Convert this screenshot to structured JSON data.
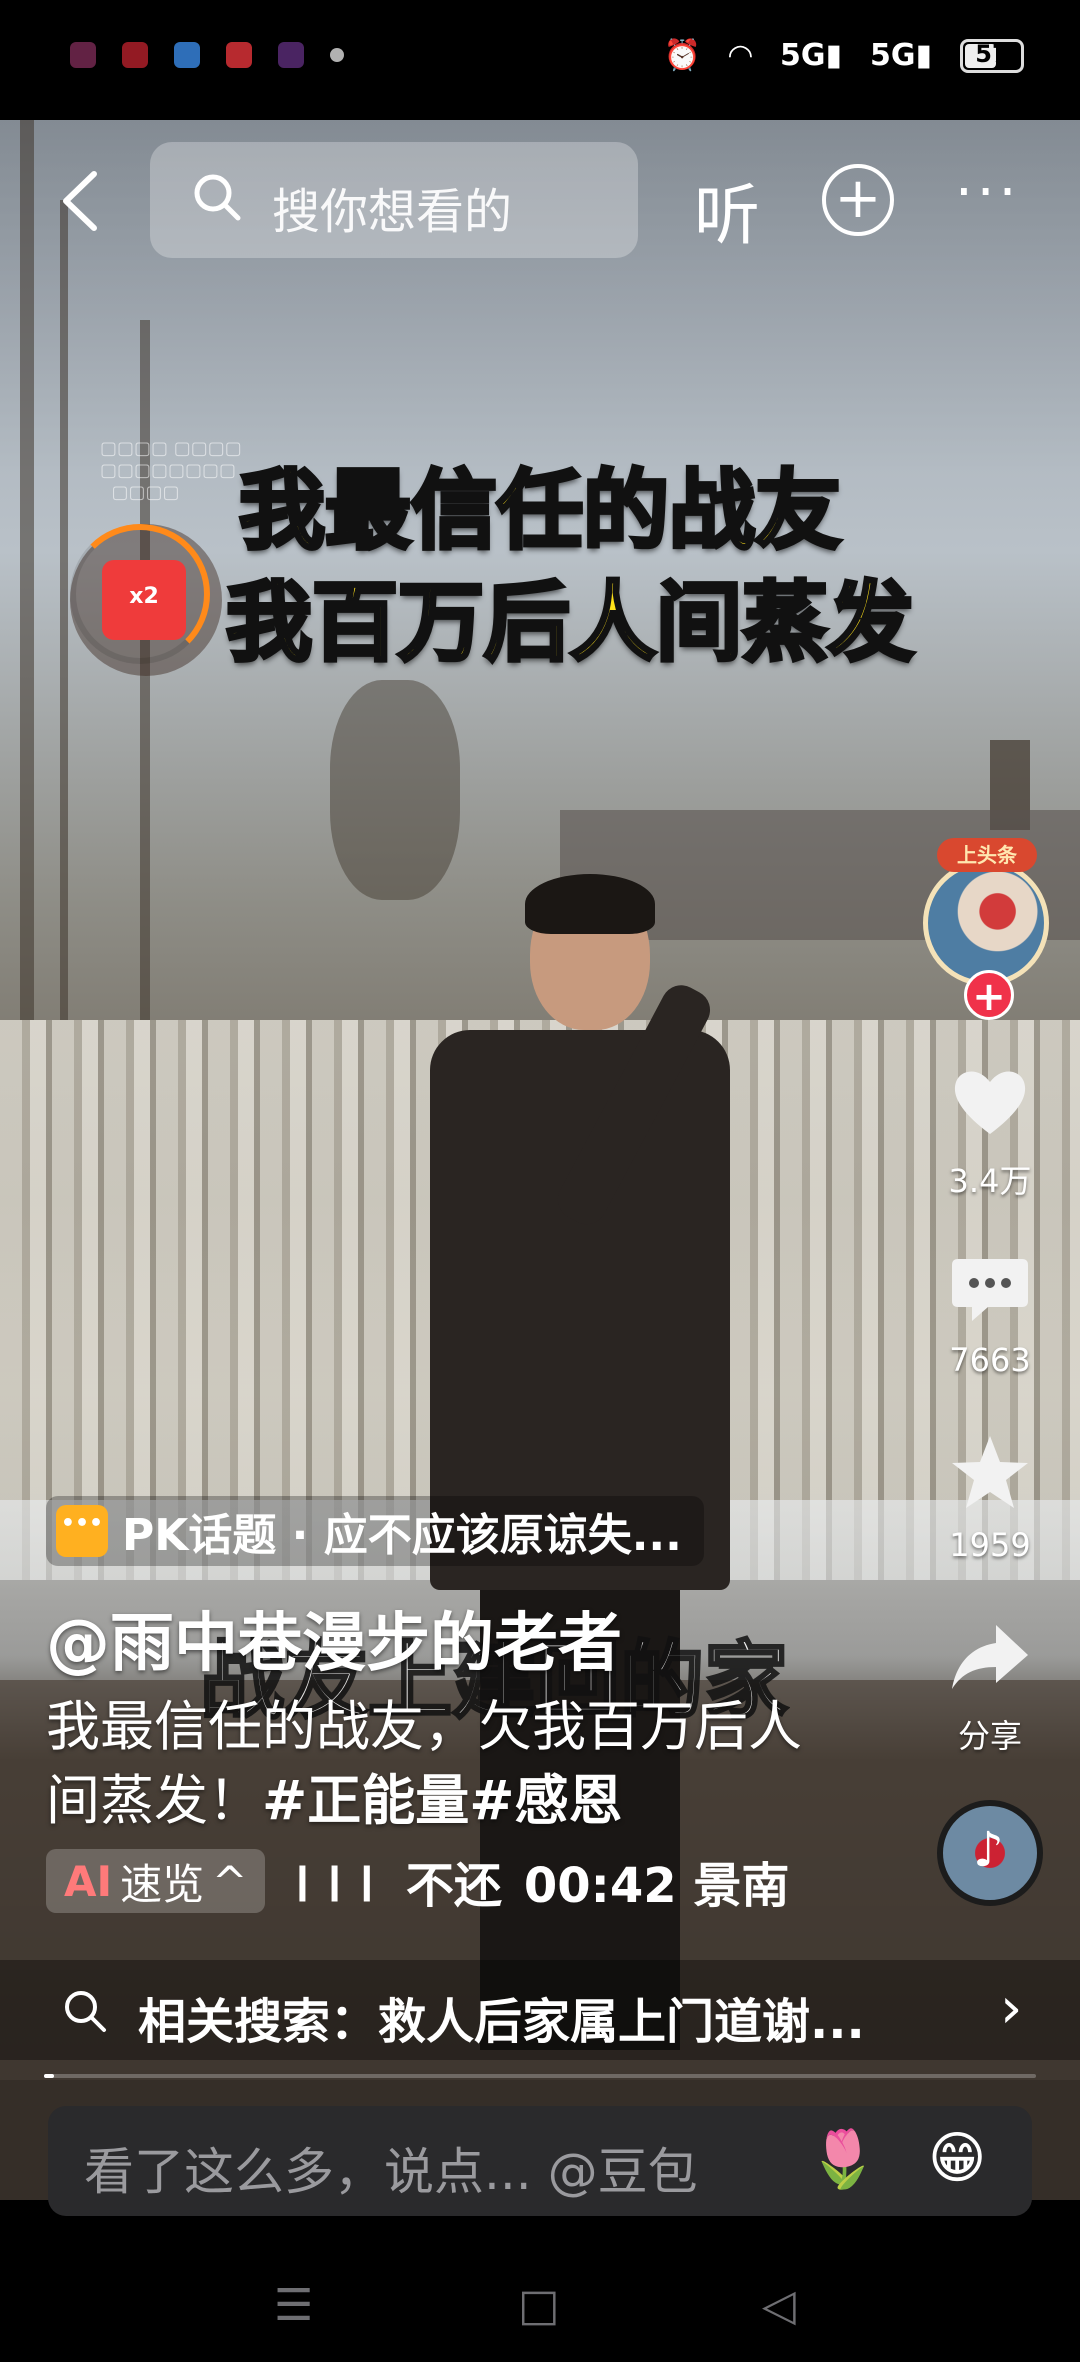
{
  "status_bar": {
    "battery_level": "57",
    "network_1": "5G",
    "network_2": "5G",
    "icons": [
      "alarm-icon",
      "wifi-icon",
      "signal-icon",
      "signal-icon",
      "battery-icon"
    ]
  },
  "top_nav": {
    "search_placeholder": "搜你想看的",
    "listen_label": "听",
    "add_icon": "plus-circle-icon",
    "more_label": "···"
  },
  "video": {
    "caption_line1": "我最信任的战友",
    "caption_line2": "我百万后人间蒸发",
    "subtitle_overlay": "战友上建回的家"
  },
  "red_packet": {
    "multiplier": "x2"
  },
  "right_rail": {
    "avatar_badge": "上头条",
    "like_count": "3.4万",
    "comment_count": "7663",
    "favorite_count": "1959",
    "share_label": "分享"
  },
  "info": {
    "pk_topic": "PK话题 · 应不应该原谅失...",
    "author": "@雨中巷漫步的老者",
    "description_text": "我最信任的战友，欠我百万后人间蒸发！",
    "tags": [
      "#正能量",
      "#感恩"
    ],
    "ai_label_a": "AI",
    "ai_label": "速览",
    "ai_chevron": "^",
    "meta_text": "不还",
    "time_text": "00:42 景南"
  },
  "related": {
    "label": "相关搜索：救人后家属上门道谢...",
    "chevron": "›"
  },
  "playback": {
    "progress": 0.01
  },
  "comment_bar": {
    "placeholder": "看了这么多，说点... @豆包",
    "flower": "🌷",
    "emoji": "😁"
  },
  "nav_bar": {
    "menu": "☰",
    "home": "□",
    "back": "◁"
  }
}
